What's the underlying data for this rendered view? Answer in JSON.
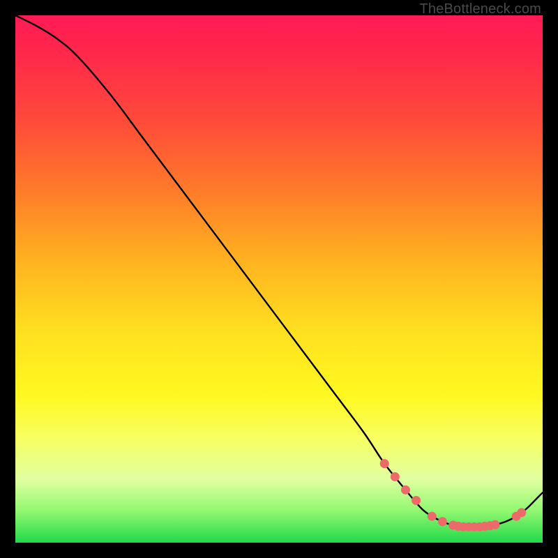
{
  "attribution": "TheBottleneck.com",
  "colors": {
    "frame": "#000000",
    "curve_stroke": "#000000",
    "marker_fill": "#ed6a6a",
    "marker_stroke": "#d14f4f"
  },
  "chart_data": {
    "type": "line",
    "title": "",
    "xlabel": "",
    "ylabel": "",
    "xlim": [
      0,
      100
    ],
    "ylim": [
      0,
      100
    ],
    "grid": false,
    "legend": false,
    "series": [
      {
        "name": "curve",
        "x": [
          0,
          4,
          8,
          12,
          18,
          24,
          30,
          36,
          42,
          48,
          54,
          60,
          66,
          70,
          74,
          77,
          79,
          81,
          83,
          85,
          87,
          89,
          91,
          93,
          95,
          97,
          99,
          100
        ],
        "y": [
          100,
          98,
          95.5,
          92,
          85,
          77,
          69,
          61,
          53,
          45,
          37,
          29,
          21,
          15,
          10,
          6.5,
          5,
          4,
          3.3,
          3,
          3,
          3.1,
          3.4,
          4,
          5,
          6.5,
          8.5,
          9.5
        ]
      }
    ],
    "markers": {
      "name": "highlight-points",
      "x": [
        70,
        72,
        74,
        76,
        79,
        81,
        83,
        84,
        85,
        86,
        87,
        88,
        89,
        90,
        91,
        95,
        96
      ],
      "y": [
        15,
        12.5,
        10,
        8,
        5,
        4,
        3.3,
        3.1,
        3,
        3,
        3,
        3,
        3.1,
        3.2,
        3.4,
        5,
        5.7
      ]
    }
  }
}
